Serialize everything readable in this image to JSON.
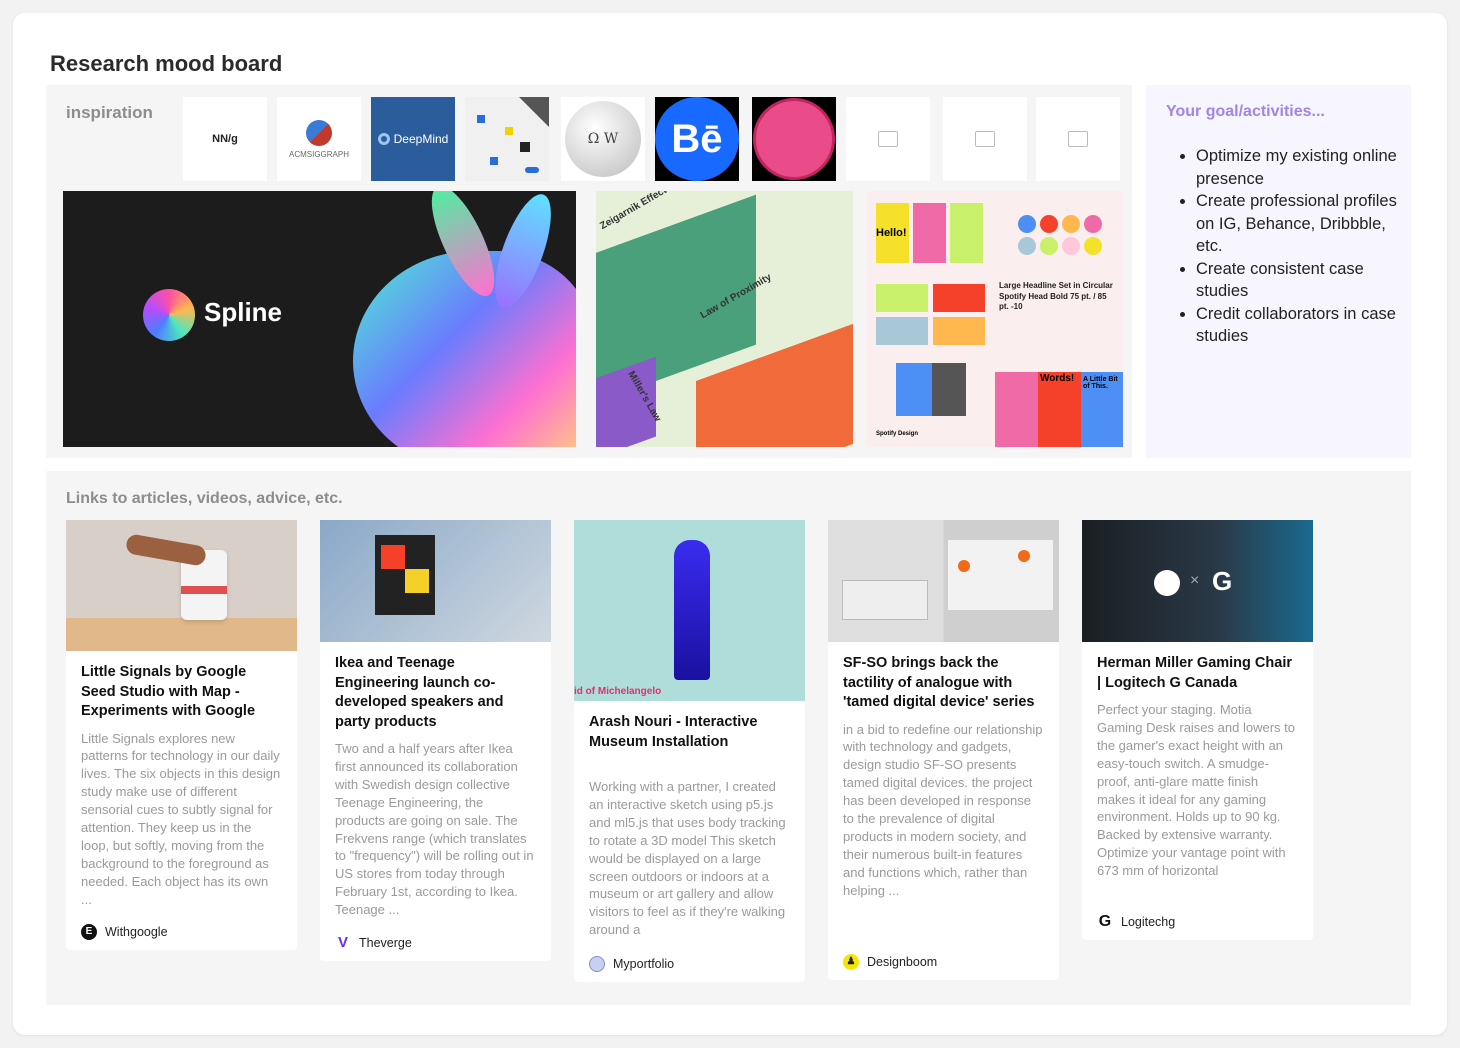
{
  "title": "Research mood board",
  "inspiration": {
    "label": "inspiration",
    "thumbnails": [
      {
        "name": "nng-logo",
        "text": "NN/g"
      },
      {
        "name": "acm-siggraph-logo",
        "text": "ACMSIGGRAPH"
      },
      {
        "name": "deepmind-logo",
        "text": "DeepMind"
      },
      {
        "name": "keyboard-photo",
        "text": ""
      },
      {
        "name": "wikipedia-logo",
        "text": ""
      },
      {
        "name": "behance-logo",
        "text": "Bē"
      },
      {
        "name": "dribbble-logo",
        "text": ""
      },
      {
        "name": "image-placeholder",
        "text": ""
      },
      {
        "name": "image-placeholder",
        "text": ""
      },
      {
        "name": "image-placeholder",
        "text": ""
      }
    ],
    "spline_text": "Spline",
    "gestalt_labels": [
      "Law of Proximity",
      "Miller's Law",
      "Zeigarnik Effect"
    ],
    "spotify": {
      "hello": "Hello!",
      "headline": "Large Headline Set in Circular Spotify Head Bold 75 pt. / 85 pt. -10",
      "words": "Words!",
      "little_bit": "A Little Bit of This.",
      "brand": "Spotify Design"
    }
  },
  "goals": {
    "heading": "Your goal/activities...",
    "items": [
      "Optimize my existing online presence",
      "Create professional profiles on IG, Behance, Dribbble, etc.",
      "Create consistent case studies",
      "Credit collaborators in case studies"
    ]
  },
  "links": {
    "label": "Links to articles, videos, advice, etc.",
    "cards": [
      {
        "title": "Little Signals by Google Seed Studio with Map - Experiments with Google",
        "desc": "Little Signals explores new patterns for technology in our daily lives. The six objects in this design study make use of different sensorial cues to subtly signal for attention. They keep us in the loop, but softly, moving from the background to the foreground as needed. Each object has its own ...",
        "source": "Withgoogle"
      },
      {
        "title": "Ikea and Teenage Engineering launch co-developed speakers and party products",
        "desc": "Two and a half years after Ikea first announced its collaboration with Swedish design collective Teenage Engineering, the products are going on sale. The Frekvens range (which translates to \"frequency\") will be rolling out in US stores from today through February 1st, according to Ikea. Teenage ...",
        "source": "Theverge"
      },
      {
        "title": "Arash Nouri - Interactive Museum Installation",
        "desc": "Working with a partner, I created an interactive sketch using p5.js and ml5.js that uses body tracking to rotate a 3D model This sketch would be displayed on a large screen outdoors or indoors at a museum or art gallery and allow visitors to feel as if they're walking around a",
        "source": "Myportfolio",
        "image_caption": "id of Michelangelo"
      },
      {
        "title": "SF-SO brings back the tactility of analogue with 'tamed digital device' series",
        "desc": "in a bid to redefine our relationship with technology and gadgets, design studio SF-SO presents tamed digital devices. the project has been developed in response to the prevalence of digital products in modern society, and their numerous built-in features and functions which, rather than helping ...",
        "source": "Designboom"
      },
      {
        "title": "Herman Miller Gaming Chair | Logitech G Canada",
        "desc": "Perfect your staging. Motia Gaming Desk raises and lowers to the gamer's exact height with an easy-touch switch. A smudge-proof, anti-glare matte finish makes it ideal for any gaming environment. Holds up to 90 kg. Backed by extensive warranty. Optimize your vantage point with 673 mm of horizontal",
        "source": "Logitechg"
      }
    ]
  },
  "colors": {
    "accent": "#a184e8",
    "panel": "#f5f5f5",
    "goals_bg": "#f7f6fe"
  }
}
